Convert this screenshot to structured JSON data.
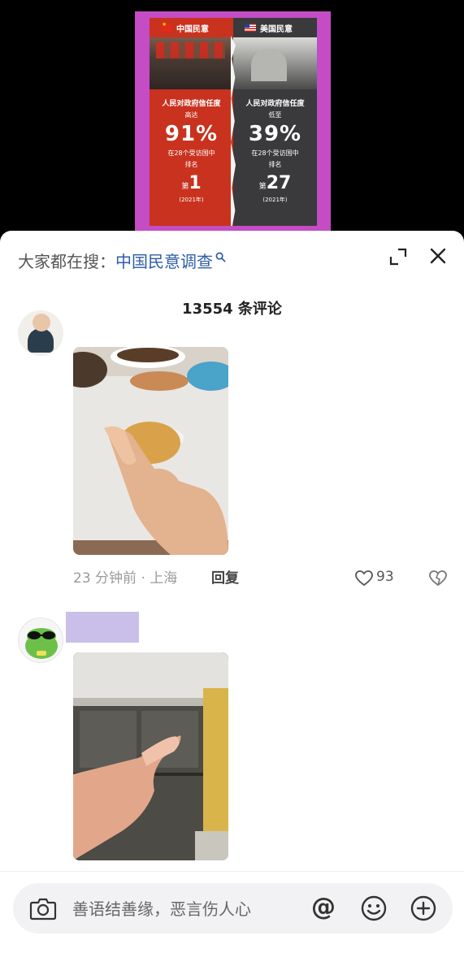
{
  "poster": {
    "left": {
      "header": "中国民意",
      "title": "人民对政府信任度",
      "qualifier": "高达",
      "percent": "91%",
      "line": "在28个受访国中",
      "line2": "排名",
      "rank_prefix": "第",
      "rank": "1",
      "year": "(2021年)"
    },
    "right": {
      "header": "美国民意",
      "title": "人民对政府信任度",
      "qualifier": "低至",
      "percent": "39%",
      "line": "在28个受访国中",
      "line2": "排名",
      "rank_prefix": "第",
      "rank": "27",
      "year": "(2021年)"
    }
  },
  "sheet": {
    "search_prefix": "大家都在搜：",
    "search_term": "中国民意调查",
    "comment_count": "13554 条评论"
  },
  "comments": [
    {
      "time_location": "23 分钟前 · 上海",
      "reply_label": "回复",
      "likes": "93"
    }
  ],
  "input": {
    "placeholder": "善语结善缘，恶言伤人心",
    "at_symbol": "@"
  }
}
